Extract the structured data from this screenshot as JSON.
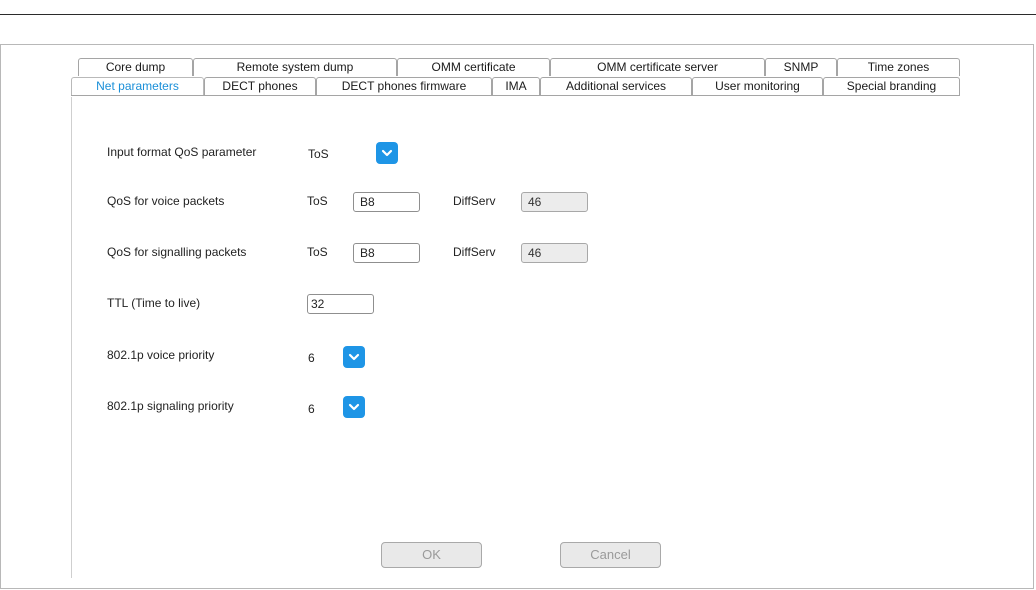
{
  "tabs_row1": [
    "Core dump",
    "Remote system dump",
    "OMM certificate",
    "OMM certificate server",
    "SNMP",
    "Time zones"
  ],
  "tabs_row2": [
    "Net parameters",
    "DECT phones",
    "DECT phones firmware",
    "IMA",
    "Additional services",
    "User monitoring",
    "Special branding"
  ],
  "active_tab": "Net parameters",
  "form": {
    "qos_format": {
      "label": "Input format QoS parameter",
      "value": "ToS"
    },
    "qos_voice": {
      "label": "QoS for voice packets",
      "tos_label": "ToS",
      "tos_value": "B8",
      "diffserv_label": "DiffServ",
      "diffserv_value": "46"
    },
    "qos_signalling": {
      "label": "QoS for signalling packets",
      "tos_label": "ToS",
      "tos_value": "B8",
      "diffserv_label": "DiffServ",
      "diffserv_value": "46"
    },
    "ttl": {
      "label": "TTL (Time to live)",
      "value": "32"
    },
    "voice_priority": {
      "label": "802.1p voice priority",
      "value": "6"
    },
    "signaling_priority": {
      "label": "802.1p signaling priority",
      "value": "6"
    }
  },
  "buttons": {
    "ok": "OK",
    "cancel": "Cancel"
  },
  "colors": {
    "accent": "#1e95e6",
    "active_tab_text": "#1a8fd8"
  }
}
